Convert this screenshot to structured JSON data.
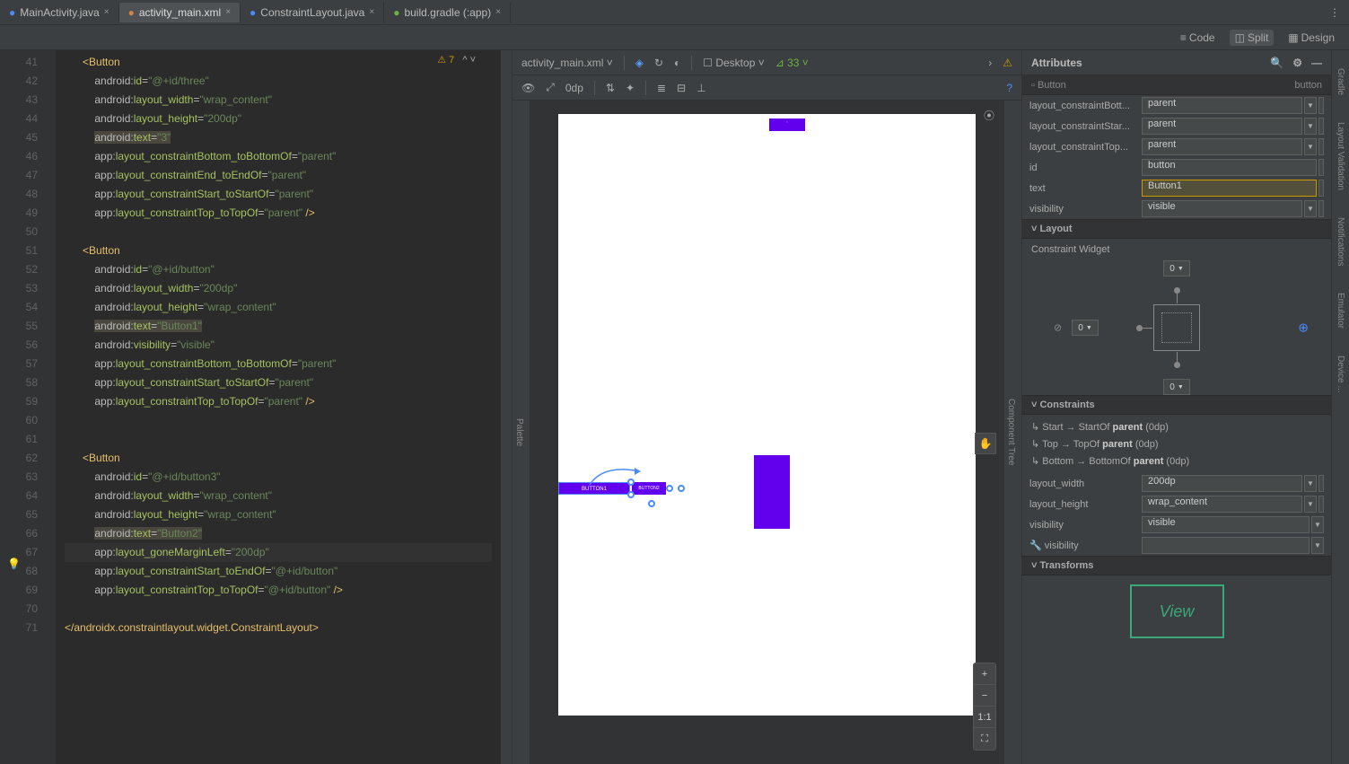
{
  "tabs": [
    {
      "label": "MainActivity.java",
      "icon": "java"
    },
    {
      "label": "activity_main.xml",
      "icon": "xml",
      "active": true
    },
    {
      "label": "ConstraintLayout.java",
      "icon": "java"
    },
    {
      "label": "build.gradle (:app)",
      "icon": "gradle"
    }
  ],
  "view_modes": {
    "code": "Code",
    "split": "Split",
    "design": "Design",
    "active": "Split"
  },
  "editor": {
    "warning_count": "7",
    "line_start": 41,
    "line_end": 72,
    "lines": [
      {
        "n": 41,
        "type": "tag-open",
        "content": "<Button"
      },
      {
        "n": 42,
        "type": "attr",
        "ns": "android",
        "name": "id",
        "val": "\"@+id/three\""
      },
      {
        "n": 43,
        "type": "attr",
        "ns": "android",
        "name": "layout_width",
        "val": "\"wrap_content\""
      },
      {
        "n": 44,
        "type": "attr",
        "ns": "android",
        "name": "layout_height",
        "val": "\"200dp\""
      },
      {
        "n": 45,
        "type": "attr-hl",
        "ns": "android",
        "name": "text",
        "val": "\"3\""
      },
      {
        "n": 46,
        "type": "attr",
        "ns": "app",
        "name": "layout_constraintBottom_toBottomOf",
        "val": "\"parent\""
      },
      {
        "n": 47,
        "type": "attr",
        "ns": "app",
        "name": "layout_constraintEnd_toEndOf",
        "val": "\"parent\""
      },
      {
        "n": 48,
        "type": "attr",
        "ns": "app",
        "name": "layout_constraintStart_toStartOf",
        "val": "\"parent\""
      },
      {
        "n": 49,
        "type": "attr-close",
        "ns": "app",
        "name": "layout_constraintTop_toTopOf",
        "val": "\"parent\""
      },
      {
        "n": 50,
        "type": "blank"
      },
      {
        "n": 51,
        "type": "tag-open",
        "content": "<Button"
      },
      {
        "n": 52,
        "type": "attr",
        "ns": "android",
        "name": "id",
        "val": "\"@+id/button\""
      },
      {
        "n": 53,
        "type": "attr",
        "ns": "android",
        "name": "layout_width",
        "val": "\"200dp\""
      },
      {
        "n": 54,
        "type": "attr",
        "ns": "android",
        "name": "layout_height",
        "val": "\"wrap_content\""
      },
      {
        "n": 55,
        "type": "attr-hl",
        "ns": "android",
        "name": "text",
        "val": "\"Button1\""
      },
      {
        "n": 56,
        "type": "attr",
        "ns": "android",
        "name": "visibility",
        "val": "\"visible\""
      },
      {
        "n": 57,
        "type": "attr",
        "ns": "app",
        "name": "layout_constraintBottom_toBottomOf",
        "val": "\"parent\""
      },
      {
        "n": 58,
        "type": "attr",
        "ns": "app",
        "name": "layout_constraintStart_toStartOf",
        "val": "\"parent\""
      },
      {
        "n": 59,
        "type": "attr-close",
        "ns": "app",
        "name": "layout_constraintTop_toTopOf",
        "val": "\"parent\""
      },
      {
        "n": 60,
        "type": "blank"
      },
      {
        "n": 61,
        "type": "blank"
      },
      {
        "n": 62,
        "type": "tag-open",
        "content": "<Button"
      },
      {
        "n": 63,
        "type": "attr",
        "ns": "android",
        "name": "id",
        "val": "\"@+id/button3\""
      },
      {
        "n": 64,
        "type": "attr",
        "ns": "android",
        "name": "layout_width",
        "val": "\"wrap_content\""
      },
      {
        "n": 65,
        "type": "attr",
        "ns": "android",
        "name": "layout_height",
        "val": "\"wrap_content\""
      },
      {
        "n": 66,
        "type": "attr-hl",
        "ns": "android",
        "name": "text",
        "val": "\"Button2\""
      },
      {
        "n": 67,
        "type": "attr-line-hl",
        "ns": "app",
        "name": "layout_goneMarginLeft",
        "val": "\"200dp\""
      },
      {
        "n": 68,
        "type": "attr",
        "ns": "app",
        "name": "layout_constraintStart_toEndOf",
        "val": "\"@+id/button\""
      },
      {
        "n": 69,
        "type": "attr-close",
        "ns": "app",
        "name": "layout_constraintTop_toTopOf",
        "val": "\"@+id/button\""
      },
      {
        "n": 70,
        "type": "blank"
      },
      {
        "n": 71,
        "type": "tag-close",
        "content": "</androidx.constraintlayout.widget.ConstraintLayout>"
      }
    ]
  },
  "design_toolbar": {
    "file": "activity_main.xml",
    "device": "Desktop",
    "api": "33",
    "dp": "0dp"
  },
  "preview": {
    "button1_label": "BUTTON1",
    "button2_label": "BUTTON2"
  },
  "zoom": {
    "plus": "+",
    "minus": "−",
    "fit": "1:1",
    "expand": "⛶"
  },
  "attributes": {
    "title": "Attributes",
    "component_type": "Button",
    "component_tag": "button",
    "rows": [
      {
        "label": "layout_constraintBott...",
        "value": "parent",
        "dropdown": true
      },
      {
        "label": "layout_constraintStar...",
        "value": "parent",
        "dropdown": true
      },
      {
        "label": "layout_constraintTop...",
        "value": "parent",
        "dropdown": true
      },
      {
        "label": "id",
        "value": "button"
      },
      {
        "label": "text",
        "value": "Button1",
        "highlight": true
      },
      {
        "label": "visibility",
        "value": "visible",
        "dropdown": true
      }
    ],
    "layout_section": "Layout",
    "constraint_widget_label": "Constraint Widget",
    "cw_top": "0",
    "cw_left": "0",
    "cw_bottom": "0",
    "constraints_section": "Constraints",
    "constraints": [
      "Start → StartOf parent (0dp)",
      "Top → TopOf parent (0dp)",
      "Bottom → BottomOf parent (0dp)"
    ],
    "layout_width": {
      "label": "layout_width",
      "value": "200dp"
    },
    "layout_height": {
      "label": "layout_height",
      "value": "wrap_content"
    },
    "vis1": {
      "label": "visibility",
      "value": "visible"
    },
    "vis2": {
      "label": "visibility",
      "value": ""
    },
    "transforms_section": "Transforms",
    "transforms_label": "View"
  },
  "side_tabs": {
    "palette": "Palette",
    "component_tree": "Component Tree"
  },
  "right_tabs": [
    "Gradle",
    "Layout Validation",
    "Notifications",
    "Emulator",
    "Device ..."
  ]
}
